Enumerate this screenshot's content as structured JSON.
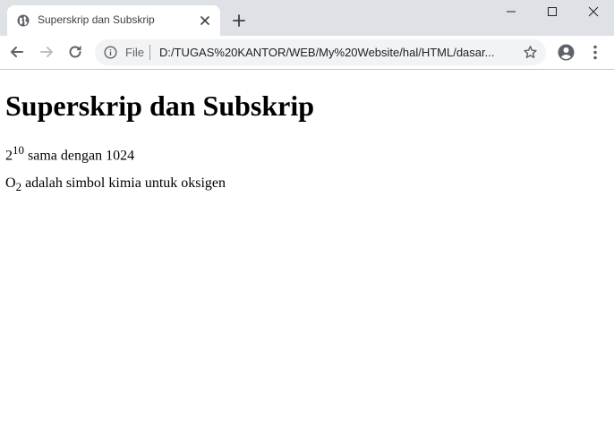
{
  "browser": {
    "tab": {
      "title": "Superskrip dan Subskrip"
    },
    "address_bar": {
      "scheme_label": "File",
      "url": "D:/TUGAS%20KANTOR/WEB/My%20Website/hal/HTML/dasar..."
    }
  },
  "page": {
    "heading": "Superskrip dan Subskrip",
    "line1": {
      "base": "2",
      "superscript": "10",
      "rest": " sama dengan 1024"
    },
    "line2": {
      "base": "O",
      "subscript": "2",
      "rest": " adalah simbol kimia untuk oksigen"
    }
  },
  "colors": {
    "tabstrip_bg": "#dee1e6",
    "omnibox_bg": "#f1f3f4",
    "icon_color": "#5f6368"
  }
}
